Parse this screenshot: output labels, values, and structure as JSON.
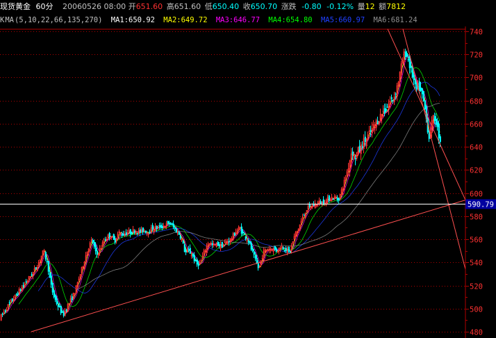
{
  "header": {
    "symbol": "现货黄金",
    "period": "60分",
    "datetime": "20060526 08:00",
    "open_label": "开",
    "open": "651.60",
    "high_label": "高",
    "high": "651.60",
    "low_label": "低",
    "low": "650.40",
    "close_label": "收",
    "close": "650.70",
    "change_label": "涨跌",
    "change": "-0.80",
    "change_pct": "-0.12%",
    "volume_label": "量",
    "volume": "12",
    "amount_label": "额",
    "amount": "7812"
  },
  "ma_bar": {
    "prefix": "K",
    "indicator": "MA",
    "params": "(5,10,22,66,135,270)",
    "items": [
      {
        "label": "MA1:650.92",
        "color": "#ffffff"
      },
      {
        "label": "MA2:649.72",
        "color": "#ffff00"
      },
      {
        "label": "MA3:646.77",
        "color": "#ff00ff"
      },
      {
        "label": "MA4:654.80",
        "color": "#00ff00"
      },
      {
        "label": "MA5:660.97",
        "color": "#2040ff"
      },
      {
        "label": "MA6:681.24",
        "color": "#909090"
      }
    ]
  },
  "price_marker": "590.79",
  "colors": {
    "up": "#ff3232",
    "down": "#00ffff",
    "grid": "#b00000",
    "trendline": "#ff5050",
    "marker_bg": "#0000a0"
  },
  "chart_data": {
    "type": "candlestick",
    "y_ticks": [
      "740",
      "720",
      "700",
      "680",
      "660",
      "640",
      "620",
      "600",
      "580",
      "560",
      "540",
      "520",
      "500",
      "480"
    ],
    "ylim": [
      475,
      745
    ],
    "grid": true,
    "close_path": [
      [
        0,
        492
      ],
      [
        8,
        500
      ],
      [
        18,
        508
      ],
      [
        28,
        516
      ],
      [
        38,
        524
      ],
      [
        48,
        532
      ],
      [
        55,
        540
      ],
      [
        62,
        550
      ],
      [
        68,
        538
      ],
      [
        72,
        522
      ],
      [
        76,
        512
      ],
      [
        80,
        506
      ],
      [
        85,
        500
      ],
      [
        90,
        494
      ],
      [
        96,
        502
      ],
      [
        102,
        508
      ],
      [
        108,
        516
      ],
      [
        114,
        528
      ],
      [
        120,
        540
      ],
      [
        126,
        552
      ],
      [
        132,
        560
      ],
      [
        138,
        546
      ],
      [
        144,
        552
      ],
      [
        150,
        560
      ],
      [
        158,
        564
      ],
      [
        164,
        558
      ],
      [
        170,
        566
      ],
      [
        176,
        564
      ],
      [
        182,
        566
      ],
      [
        188,
        566
      ],
      [
        194,
        568
      ],
      [
        200,
        566
      ],
      [
        206,
        568
      ],
      [
        212,
        566
      ],
      [
        220,
        570
      ],
      [
        228,
        570
      ],
      [
        236,
        572
      ],
      [
        244,
        574
      ],
      [
        252,
        568
      ],
      [
        258,
        564
      ],
      [
        262,
        558
      ],
      [
        266,
        548
      ],
      [
        270,
        550
      ],
      [
        274,
        548
      ],
      [
        278,
        544
      ],
      [
        282,
        538
      ],
      [
        288,
        540
      ],
      [
        294,
        550
      ],
      [
        300,
        558
      ],
      [
        306,
        554
      ],
      [
        312,
        556
      ],
      [
        318,
        554
      ],
      [
        326,
        558
      ],
      [
        332,
        560
      ],
      [
        338,
        566
      ],
      [
        344,
        570
      ],
      [
        350,
        564
      ],
      [
        356,
        560
      ],
      [
        362,
        550
      ],
      [
        368,
        540
      ],
      [
        372,
        534
      ],
      [
        376,
        544
      ],
      [
        380,
        550
      ],
      [
        386,
        552
      ],
      [
        392,
        552
      ],
      [
        398,
        550
      ],
      [
        404,
        554
      ],
      [
        410,
        552
      ],
      [
        416,
        548
      ],
      [
        420,
        556
      ],
      [
        424,
        564
      ],
      [
        428,
        568
      ],
      [
        432,
        574
      ],
      [
        436,
        580
      ],
      [
        440,
        586
      ],
      [
        446,
        588
      ],
      [
        452,
        590
      ],
      [
        458,
        592
      ],
      [
        464,
        592
      ],
      [
        470,
        594
      ],
      [
        476,
        596
      ],
      [
        482,
        596
      ],
      [
        486,
        594
      ],
      [
        490,
        600
      ],
      [
        494,
        608
      ],
      [
        498,
        616
      ],
      [
        502,
        626
      ],
      [
        506,
        638
      ],
      [
        510,
        630
      ],
      [
        514,
        636
      ],
      [
        518,
        638
      ],
      [
        522,
        644
      ],
      [
        526,
        646
      ],
      [
        530,
        650
      ],
      [
        534,
        654
      ],
      [
        538,
        658
      ],
      [
        542,
        662
      ],
      [
        546,
        666
      ],
      [
        550,
        670
      ],
      [
        554,
        672
      ],
      [
        558,
        676
      ],
      [
        562,
        680
      ],
      [
        566,
        682
      ],
      [
        570,
        690
      ],
      [
        574,
        700
      ],
      [
        578,
        712
      ],
      [
        582,
        722
      ],
      [
        586,
        718
      ],
      [
        590,
        708
      ],
      [
        594,
        700
      ],
      [
        598,
        688
      ],
      [
        602,
        692
      ],
      [
        606,
        686
      ],
      [
        610,
        676
      ],
      [
        614,
        660
      ],
      [
        617,
        648
      ],
      [
        620,
        658
      ],
      [
        624,
        666
      ],
      [
        627,
        662
      ],
      [
        630,
        652
      ],
      [
        633,
        646
      ]
    ]
  }
}
